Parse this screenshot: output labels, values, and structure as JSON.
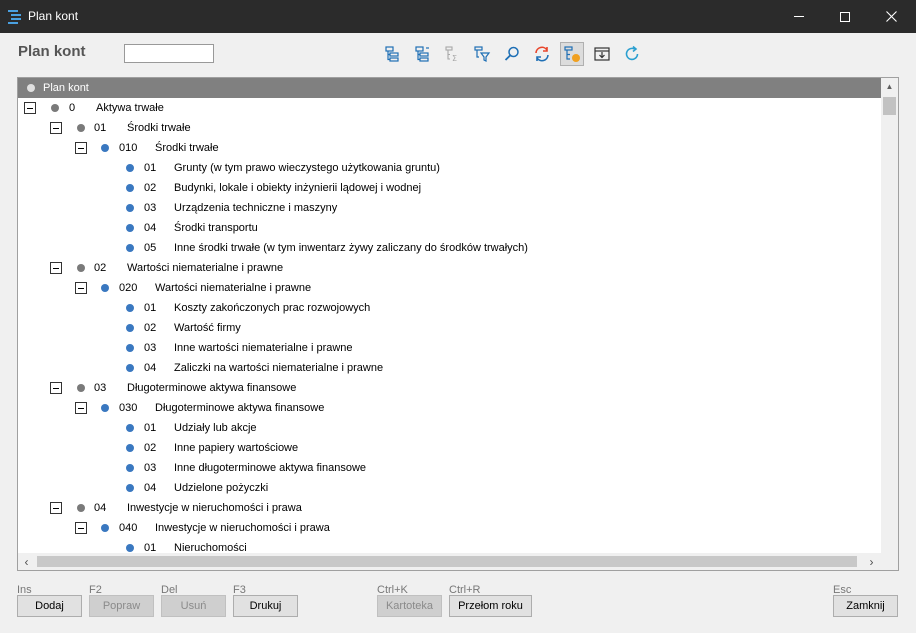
{
  "window": {
    "title": "Plan kont"
  },
  "header": {
    "title": "Plan kont",
    "filter_value": ""
  },
  "toolbar": {
    "tools": [
      {
        "icon": "tree-expand-icon"
      },
      {
        "icon": "tree-collapse-icon"
      },
      {
        "icon": "tree-sum-icon"
      },
      {
        "icon": "tree-filter-icon"
      },
      {
        "icon": "search-icon"
      },
      {
        "icon": "refresh-sync-icon"
      },
      {
        "icon": "tree-highlight-icon"
      },
      {
        "icon": "export-icon"
      },
      {
        "icon": "reload-icon"
      }
    ]
  },
  "tree": {
    "column_header": "Plan kont",
    "rows": [
      {
        "level": 0,
        "expandable": true,
        "dot": "gray",
        "code": "0",
        "name": "Aktywa trwałe"
      },
      {
        "level": 1,
        "expandable": true,
        "dot": "gray",
        "code": "01",
        "name": "Środki trwałe"
      },
      {
        "level": 2,
        "expandable": true,
        "dot": "blue",
        "code": "010",
        "name": "Środki trwałe"
      },
      {
        "level": 3,
        "expandable": false,
        "dot": "blue",
        "code": "01",
        "name": "Grunty (w tym prawo wieczystego użytkowania gruntu)"
      },
      {
        "level": 3,
        "expandable": false,
        "dot": "blue",
        "code": "02",
        "name": "Budynki, lokale i obiekty inżynierii lądowej i wodnej"
      },
      {
        "level": 3,
        "expandable": false,
        "dot": "blue",
        "code": "03",
        "name": "Urządzenia techniczne i maszyny"
      },
      {
        "level": 3,
        "expandable": false,
        "dot": "blue",
        "code": "04",
        "name": "Środki transportu"
      },
      {
        "level": 3,
        "expandable": false,
        "dot": "blue",
        "code": "05",
        "name": "Inne środki trwałe (w tym inwentarz żywy zaliczany do środków trwałych)"
      },
      {
        "level": 1,
        "expandable": true,
        "dot": "gray",
        "code": "02",
        "name": "Wartości niematerialne i prawne"
      },
      {
        "level": 2,
        "expandable": true,
        "dot": "blue",
        "code": "020",
        "name": "Wartości niematerialne i prawne"
      },
      {
        "level": 3,
        "expandable": false,
        "dot": "blue",
        "code": "01",
        "name": "Koszty zakończonych prac rozwojowych"
      },
      {
        "level": 3,
        "expandable": false,
        "dot": "blue",
        "code": "02",
        "name": "Wartość firmy"
      },
      {
        "level": 3,
        "expandable": false,
        "dot": "blue",
        "code": "03",
        "name": "Inne wartości niematerialne i prawne"
      },
      {
        "level": 3,
        "expandable": false,
        "dot": "blue",
        "code": "04",
        "name": "Zaliczki na wartości niematerialne i prawne"
      },
      {
        "level": 1,
        "expandable": true,
        "dot": "gray",
        "code": "03",
        "name": "Długoterminowe aktywa finansowe"
      },
      {
        "level": 2,
        "expandable": true,
        "dot": "blue",
        "code": "030",
        "name": "Długoterminowe aktywa finansowe"
      },
      {
        "level": 3,
        "expandable": false,
        "dot": "blue",
        "code": "01",
        "name": "Udziały lub akcje"
      },
      {
        "level": 3,
        "expandable": false,
        "dot": "blue",
        "code": "02",
        "name": "Inne papiery wartościowe"
      },
      {
        "level": 3,
        "expandable": false,
        "dot": "blue",
        "code": "03",
        "name": "Inne długoterminowe aktywa finansowe"
      },
      {
        "level": 3,
        "expandable": false,
        "dot": "blue",
        "code": "04",
        "name": "Udzielone pożyczki"
      },
      {
        "level": 1,
        "expandable": true,
        "dot": "gray",
        "code": "04",
        "name": "Inwestycje w nieruchomości i prawa"
      },
      {
        "level": 2,
        "expandable": true,
        "dot": "blue",
        "code": "040",
        "name": "Inwestycje w nieruchomości i prawa"
      },
      {
        "level": 3,
        "expandable": false,
        "dot": "blue",
        "code": "01",
        "name": "Nieruchomości"
      }
    ]
  },
  "footer": {
    "buttons": [
      {
        "key": "Ins",
        "label": "Dodaj",
        "enabled": true
      },
      {
        "key": "F2",
        "label": "Popraw",
        "enabled": false
      },
      {
        "key": "Del",
        "label": "Usuń",
        "enabled": false
      },
      {
        "key": "F3",
        "label": "Drukuj",
        "enabled": true
      },
      {
        "key": "Ctrl+K",
        "label": "Kartoteka",
        "enabled": false
      },
      {
        "key": "Ctrl+R",
        "label": "Przełom roku",
        "enabled": true
      },
      {
        "key": "Esc",
        "label": "Zamknij",
        "enabled": true
      }
    ]
  },
  "colors": {
    "node_blue": "#3a78c0",
    "node_gray": "#7a7a7a",
    "header_gray": "#808080",
    "titlebar": "#2b2b2b"
  }
}
